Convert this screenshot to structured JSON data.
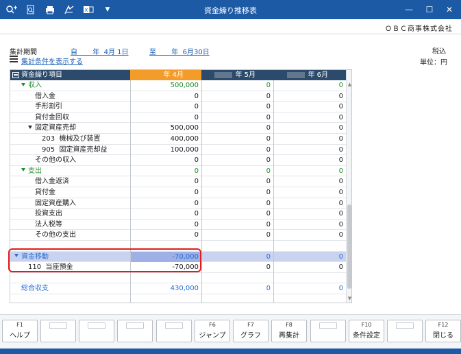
{
  "window": {
    "title": "資金繰り推移表",
    "minimize": "—",
    "maximize": "☐",
    "close": "✕"
  },
  "toolbar": {
    "icons": [
      "search-plus-icon",
      "preview-icon",
      "print-icon",
      "pdf-export-icon",
      "excel-export-icon",
      "dropdown-icon"
    ]
  },
  "company": "ＯＢＣ商事株式会社",
  "period": {
    "label": "集計期間",
    "from": "自       年  4月 1日",
    "to": "至       年  6月30日"
  },
  "tax": "税込",
  "unit": "単位：円",
  "conditions_link": "集計条件を表示する",
  "grid": {
    "columns": [
      "資金繰り項目",
      "年  4月",
      "年  5月",
      "年  6月"
    ],
    "rows": [
      {
        "label": "収入",
        "v": [
          "500,000",
          "0",
          "0"
        ],
        "color": "green",
        "indent": 1,
        "expand": true
      },
      {
        "label": "借入金",
        "v": [
          "0",
          "0",
          "0"
        ],
        "indent": 3
      },
      {
        "label": "手形割引",
        "v": [
          "0",
          "0",
          "0"
        ],
        "indent": 3
      },
      {
        "label": "貸付金回収",
        "v": [
          "0",
          "0",
          "0"
        ],
        "indent": 3
      },
      {
        "label": "固定資産売却",
        "v": [
          "500,000",
          "0",
          "0"
        ],
        "indent": 2,
        "expand": true
      },
      {
        "label": "203  機械及び装置",
        "v": [
          "400,000",
          "0",
          "0"
        ],
        "indent": 4
      },
      {
        "label": "905  固定資産売却益",
        "v": [
          "100,000",
          "0",
          "0"
        ],
        "indent": 4
      },
      {
        "label": "その他の収入",
        "v": [
          "0",
          "0",
          "0"
        ],
        "indent": 3
      },
      {
        "label": "支出",
        "v": [
          "0",
          "0",
          "0"
        ],
        "color": "green",
        "indent": 1,
        "expand": true
      },
      {
        "label": "借入金返済",
        "v": [
          "0",
          "0",
          "0"
        ],
        "indent": 3
      },
      {
        "label": "貸付金",
        "v": [
          "0",
          "0",
          "0"
        ],
        "indent": 3
      },
      {
        "label": "固定資産購入",
        "v": [
          "0",
          "0",
          "0"
        ],
        "indent": 3
      },
      {
        "label": "投資支出",
        "v": [
          "0",
          "0",
          "0"
        ],
        "indent": 3
      },
      {
        "label": "法人税等",
        "v": [
          "0",
          "0",
          "0"
        ],
        "indent": 3
      },
      {
        "label": "その他の支出",
        "v": [
          "0",
          "0",
          "0"
        ],
        "indent": 3
      },
      {
        "label": "",
        "v": [
          "",
          "",
          ""
        ],
        "indent": 0
      },
      {
        "label": "資金移動",
        "v": [
          "-70,000",
          "0",
          "0"
        ],
        "color": "blue",
        "indent": 0,
        "expand": true,
        "selected": true
      },
      {
        "label": "110  当座預金",
        "v": [
          "-70,000",
          "0",
          "0"
        ],
        "indent": 2
      },
      {
        "label": "",
        "v": [
          "",
          "",
          ""
        ],
        "indent": 0
      },
      {
        "label": "総合収支",
        "v": [
          "430,000",
          "0",
          "0"
        ],
        "color": "blue",
        "indent": 1
      },
      {
        "label": "",
        "v": [
          "",
          "",
          ""
        ],
        "indent": 0
      }
    ]
  },
  "fkeys": [
    {
      "key": "F1",
      "label": "ヘルプ"
    },
    {
      "key": "",
      "label": ""
    },
    {
      "key": "",
      "label": ""
    },
    {
      "key": "",
      "label": ""
    },
    {
      "key": "",
      "label": ""
    },
    {
      "key": "F6",
      "label": "ジャンプ"
    },
    {
      "key": "F7",
      "label": "グラフ"
    },
    {
      "key": "F8",
      "label": "再集計"
    },
    {
      "key": "",
      "label": ""
    },
    {
      "key": "F10",
      "label": "条件設定"
    },
    {
      "key": "",
      "label": ""
    },
    {
      "key": "F12",
      "label": "閉じる"
    }
  ],
  "colors": {
    "titlebar": "#1c5aa6",
    "header": "#2c4a6b",
    "current_month": "#f39c2a",
    "selected_row": "#c9d3f0",
    "highlight": "#e01c1c"
  }
}
